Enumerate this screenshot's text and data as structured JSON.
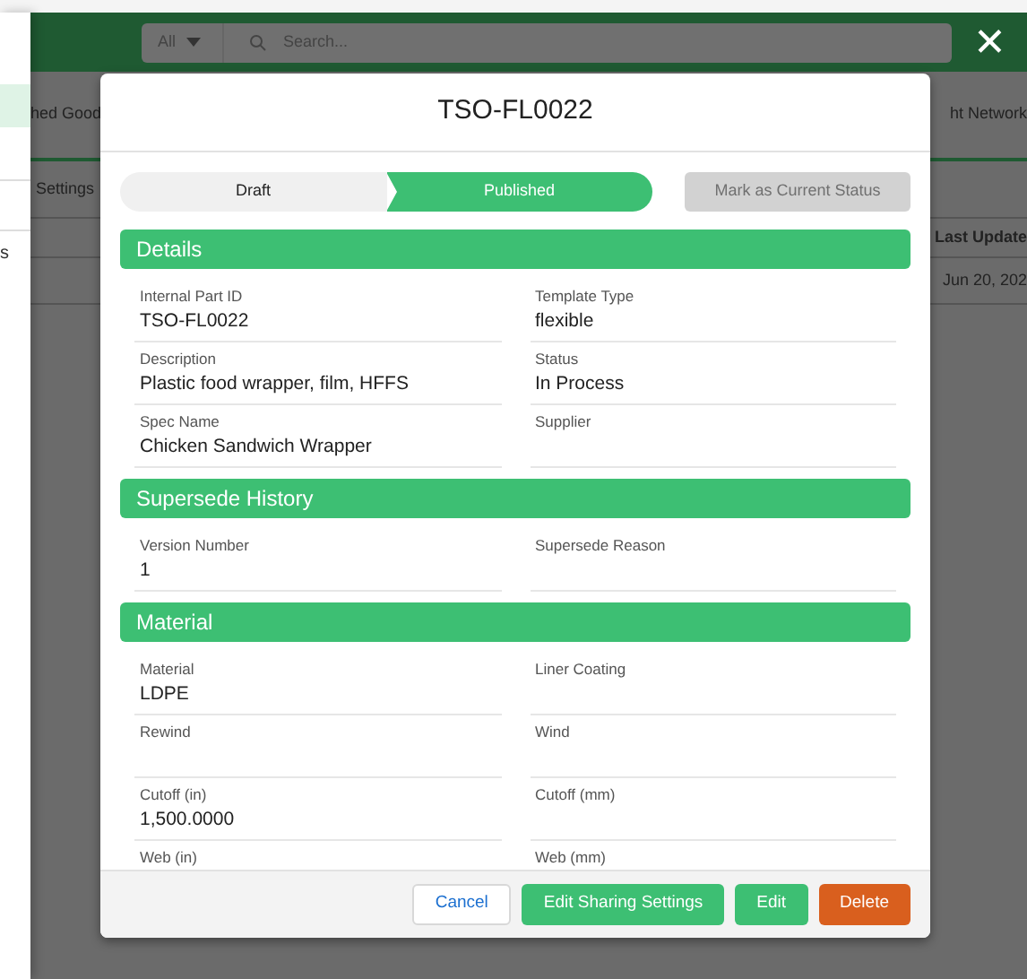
{
  "side_panel": {
    "text": "s"
  },
  "app_header": {
    "scope": "All",
    "search_placeholder": "Search...",
    "close": "✕"
  },
  "background": {
    "tab_left": "hed Good",
    "tab_right": "ht Network",
    "row_label": "Settings",
    "column_heading": "Last Update",
    "cell": "Jun 20, 202"
  },
  "modal": {
    "title": "TSO-FL0022",
    "status_path": [
      {
        "label": "Draft",
        "selected": false
      },
      {
        "label": "Published",
        "selected": true
      }
    ],
    "mark_button": {
      "label": "Mark as Current Status",
      "disabled": true
    },
    "sections": [
      {
        "title": "Details",
        "fields": [
          {
            "label": "Internal Part ID",
            "value": "TSO-FL0022"
          },
          {
            "label": "Template Type",
            "value": "flexible"
          },
          {
            "label": "Description",
            "value": "Plastic food wrapper, film, HFFS"
          },
          {
            "label": "Status",
            "value": "In Process"
          },
          {
            "label": "Spec Name",
            "value": "Chicken Sandwich Wrapper"
          },
          {
            "label": "Supplier"
          }
        ]
      },
      {
        "title": "Supersede History",
        "fields": [
          {
            "label": "Version Number",
            "value": "1"
          },
          {
            "label": "Supersede Reason"
          }
        ]
      },
      {
        "title": "Material",
        "fields": [
          {
            "label": "Material",
            "value": "LDPE"
          },
          {
            "label": "Liner Coating"
          },
          {
            "label": "Rewind"
          },
          {
            "label": "Wind"
          },
          {
            "label": "Cutoff (in)",
            "value": "1,500.0000"
          },
          {
            "label": "Cutoff (mm)"
          },
          {
            "label": "Web (in)"
          },
          {
            "label": "Web (mm)"
          }
        ]
      }
    ],
    "buttons": [
      {
        "label": "Cancel",
        "kind": "neutral"
      },
      {
        "label": "Edit Sharing Settings",
        "kind": "primary"
      },
      {
        "label": "Edit",
        "kind": "primary"
      },
      {
        "label": "Delete",
        "kind": "danger"
      }
    ]
  }
}
